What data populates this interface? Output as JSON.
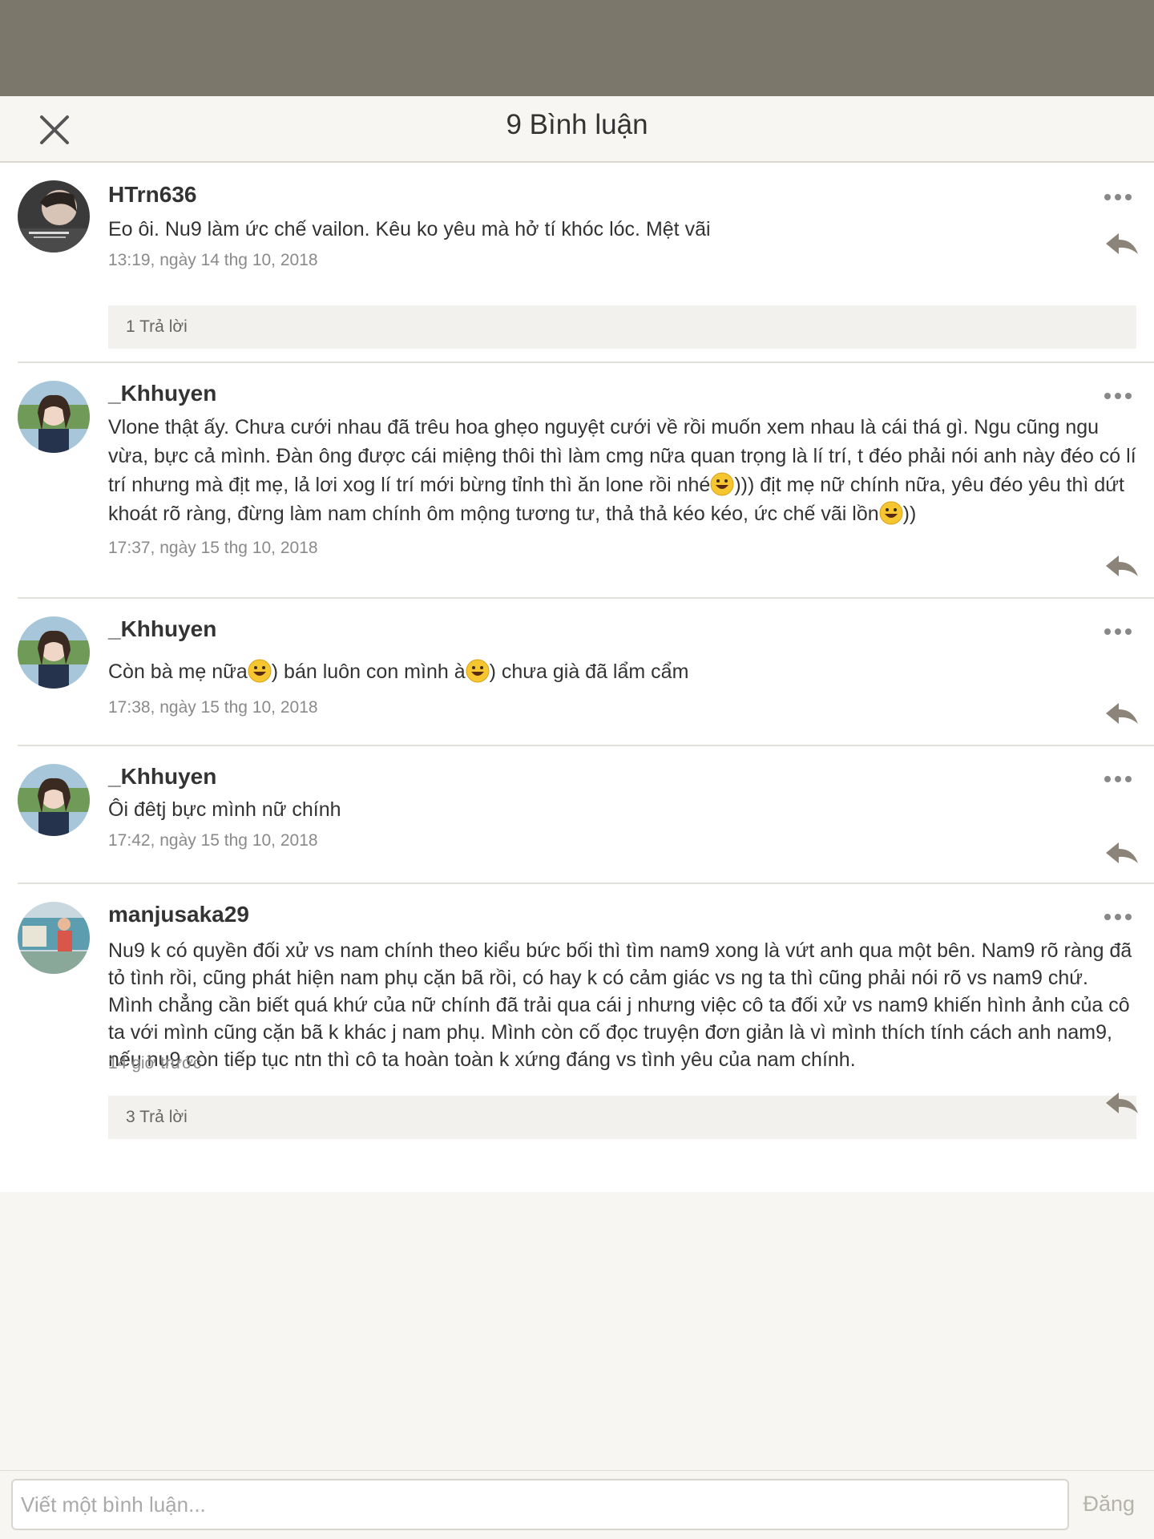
{
  "header": {
    "title": "9 Bình luận"
  },
  "comments": [
    {
      "user": "HTrn636",
      "text": "Eo ôi. Nu9 làm ức chế vailon. Kêu ko yêu mà hở tí khóc lóc. Mệt vãi",
      "time": "13:19, ngày 14 thg 10, 2018",
      "replies": "1 Trả lời"
    },
    {
      "user": "_Khhuyen",
      "text_1": "Vlone thật ấy. Chưa cưới nhau đã trêu hoa ghẹo nguyệt cưới về rồi muốn xem nhau là cái thá gì. Ngu cũng ngu vừa, bực cả mình. Đàn ông được cái miệng thôi thì làm cmg nữa quan trọng là lí trí, t đéo phải nói anh này đéo có lí trí nhưng mà địt mẹ, lả lơi xog lí trí mới bừng tỉnh thì ăn lone rồi nhé",
      "text_2": "))) địt mẹ nữ chính nữa, yêu đéo yêu thì dứt khoát rõ ràng, đừng làm nam chính ôm mộng tương tư, thả thả kéo kéo, ức chế vãi lồn",
      "text_3": "))",
      "time": "17:37, ngày 15 thg 10, 2018"
    },
    {
      "user": "_Khhuyen",
      "text_1": "Còn bà mẹ nữa",
      "text_2": ") bán luôn con mình à",
      "text_3": ") chưa già đã lẩm cẩm",
      "time": "17:38, ngày 15 thg 10, 2018"
    },
    {
      "user": "_Khhuyen",
      "text": "Ôi đêtj bực mình nữ chính",
      "time": "17:42, ngày 15 thg 10, 2018"
    },
    {
      "user": "manjusaka29",
      "text": "Nu9 k có quyền đối xử vs nam chính theo kiểu bức bối thì tìm nam9 xong là vứt anh qua một bên. Nam9 rõ ràng đã tỏ tình rồi, cũng phát hiện nam phụ cặn bã rồi, có hay k có cảm giác vs ng ta thì cũng phải nói rõ vs nam9 chứ. Mình chẳng cần biết quá khứ của nữ chính đã trải qua cái j nhưng việc cô ta đối xử vs nam9 khiến hình ảnh của cô ta với mình cũng cặn bã k khác j nam phụ. Mình còn cố đọc truyện đơn giản là vì mình thích tính cách anh nam9, nếu nu9 còn tiếp tục ntn thì cô ta hoàn toàn k xứng đáng vs tình yêu của nam chính.",
      "time": "14 giờ trước",
      "replies": "3 Trả lời"
    }
  ],
  "footer": {
    "placeholder": "Viết một bình luận...",
    "post_label": "Đăng"
  },
  "colors": {
    "overlay": "#7b776b",
    "sheet": "#f7f6f2",
    "icon": "#8c8478"
  }
}
